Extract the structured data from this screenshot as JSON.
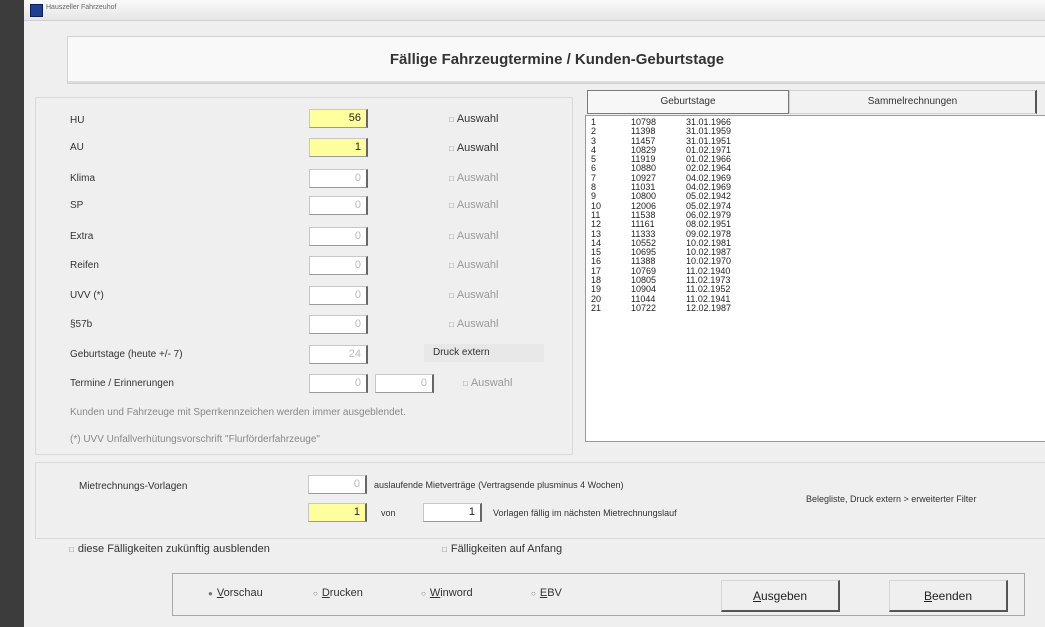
{
  "window": {
    "title": "Hauszeller Fahrzeuhof"
  },
  "header": {
    "title": "Fällige Fahrzeugtermine / Kunden-Geburtstage"
  },
  "rows": [
    {
      "label": "HU",
      "value": "56",
      "checkbox": "Auswahl"
    },
    {
      "label": "AU",
      "value": "1",
      "checkbox": "Auswahl"
    },
    {
      "label": "Klima",
      "value": "0",
      "checkbox": "Auswahl"
    },
    {
      "label": "SP",
      "value": "0",
      "checkbox": "Auswahl"
    },
    {
      "label": "Extra",
      "value": "0",
      "checkbox": "Auswahl"
    },
    {
      "label": "Reifen",
      "value": "0",
      "checkbox": "Auswahl"
    },
    {
      "label": "UVV (*)",
      "value": "0",
      "checkbox": "Auswahl"
    },
    {
      "label": "§57b",
      "value": "0",
      "checkbox": "Auswahl"
    },
    {
      "label": "Geburtstage (heute +/- 7)",
      "value": "24",
      "info": "Druck extern"
    },
    {
      "label": "Termine / Erinnerungen",
      "value": "0",
      "value2": "0",
      "checkbox": "Auswahl"
    }
  ],
  "notes": {
    "sperr": "Kunden und Fahrzeuge mit Sperrkennzeichen werden immer ausgeblendet.",
    "uvv": "(*) UVV Unfallverhütungsvorschrift \"Flurförderfahrzeuge\""
  },
  "tabs": {
    "geburtstage": "Geburtstage",
    "sammel": "Sammelrechnungen"
  },
  "birthdays": [
    [
      "1",
      "10798",
      "31.01.1966"
    ],
    [
      "2",
      "11398",
      "31.01.1959"
    ],
    [
      "3",
      "11457",
      "31.01.1951"
    ],
    [
      "4",
      "10829",
      "01.02.1971"
    ],
    [
      "5",
      "11919",
      "01.02.1966"
    ],
    [
      "6",
      "10880",
      "02.02.1964"
    ],
    [
      "7",
      "10927",
      "04.02.1969"
    ],
    [
      "8",
      "11031",
      "04.02.1969"
    ],
    [
      "9",
      "10800",
      "05.02.1942"
    ],
    [
      "10",
      "12006",
      "05.02.1974"
    ],
    [
      "11",
      "11538",
      "06.02.1979"
    ],
    [
      "12",
      "11161",
      "08.02.1951"
    ],
    [
      "13",
      "11333",
      "09.02.1978"
    ],
    [
      "14",
      "10552",
      "10.02.1981"
    ],
    [
      "15",
      "10695",
      "10.02.1987"
    ],
    [
      "16",
      "11388",
      "10.02.1970"
    ],
    [
      "17",
      "10769",
      "11.02.1940"
    ],
    [
      "18",
      "10805",
      "11.02.1973"
    ],
    [
      "19",
      "10904",
      "11.02.1952"
    ],
    [
      "20",
      "11044",
      "11.02.1941"
    ],
    [
      "21",
      "10722",
      "12.02.1987"
    ]
  ],
  "miet": {
    "label": "Mietrechnungs-Vorlagen",
    "auslaufend_value": "0",
    "auslaufend_text": "auslaufende Mietverträge (Vertragsende plusminus 4 Wochen)",
    "faellig_value": "1",
    "von": "von",
    "gesamt_value": "1",
    "vorlagen_text": "Vorlagen fällig im nächsten Mietrechnungslauf",
    "beleg_text": "Belegliste, Druck extern > erweiterter Filter"
  },
  "options": {
    "ausblenden": "diese Fälligkeiten zukünftig ausblenden",
    "anfang": "Fälligkeiten auf Anfang"
  },
  "output": {
    "vorschau": {
      "first": "V",
      "rest": "orschau"
    },
    "drucken": {
      "first": "D",
      "rest": "rucken"
    },
    "winword": {
      "first": "W",
      "rest": "inword"
    },
    "ebv": {
      "first": "E",
      "rest": "BV"
    },
    "ausgeben": {
      "first": "A",
      "rest": "usgeben"
    },
    "beenden": {
      "first": "B",
      "rest": "eenden"
    }
  },
  "colors": {
    "highlight_field": "#ffff9e",
    "app_bg": "#efefef",
    "desktop_bg": "#3c3c3c"
  }
}
